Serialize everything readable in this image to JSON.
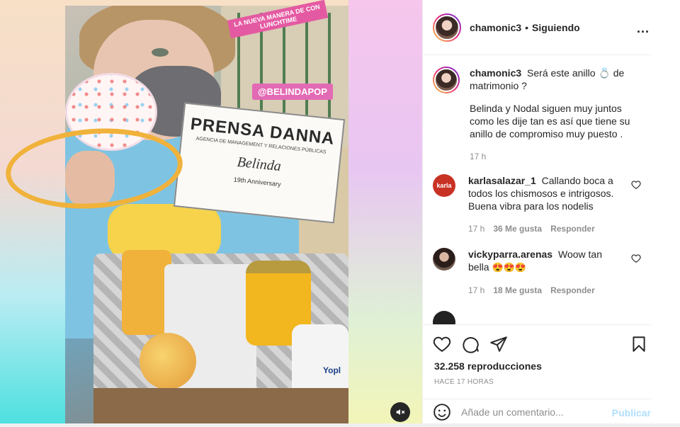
{
  "post": {
    "overlay_top": "LA NUEVA MANERA DE CON LUNCHTIME",
    "overlay_handle": "@BELINDAPOP",
    "card_title": "PRENSA DANNA",
    "card_subtitle": "AGENCIA DE MANAGEMENT Y RELACIONES PÚBLICAS",
    "card_name": "Belinda",
    "card_anniversary": "19th Anniversary",
    "bottle_brand": "Yopl",
    "mute_icon": "speaker-muted-icon"
  },
  "header": {
    "username": "chamonic3",
    "separator": "•",
    "follow_status": "Siguiendo",
    "more": "..."
  },
  "caption": {
    "username": "chamonic3",
    "text_part1": "Será este anillo",
    "ring_emoji": "💍",
    "text_part2": "de matrimonio ?",
    "paragraph": "Belinda y Nodal siguen muy juntos como les dije tan es así que tiene su anillo de compromiso muy puesto .",
    "time": "17 h"
  },
  "comments": [
    {
      "username": "karlasalazar_1",
      "avatar_text": "karla",
      "text": "Callando boca a todos los chismosos e intrigosos. Buena vibra para los nodelis",
      "time": "17 h",
      "likes": "36 Me gusta",
      "reply": "Responder"
    },
    {
      "username": "vickyparra.arenas",
      "text": "Woow tan bella",
      "emojis": "😍😍😍",
      "time": "17 h",
      "likes": "18 Me gusta",
      "reply": "Responder"
    }
  ],
  "actions": {
    "views_count": "32.258",
    "views_label": "reproducciones",
    "timeago": "HACE 17 HORAS",
    "comment_placeholder": "Añade un comentario...",
    "publish": "Publicar"
  },
  "colors": {
    "publish_disabled": "#b2dffc",
    "text_secondary": "#8e8e8e",
    "highlight_circle": "#f0b23a"
  }
}
